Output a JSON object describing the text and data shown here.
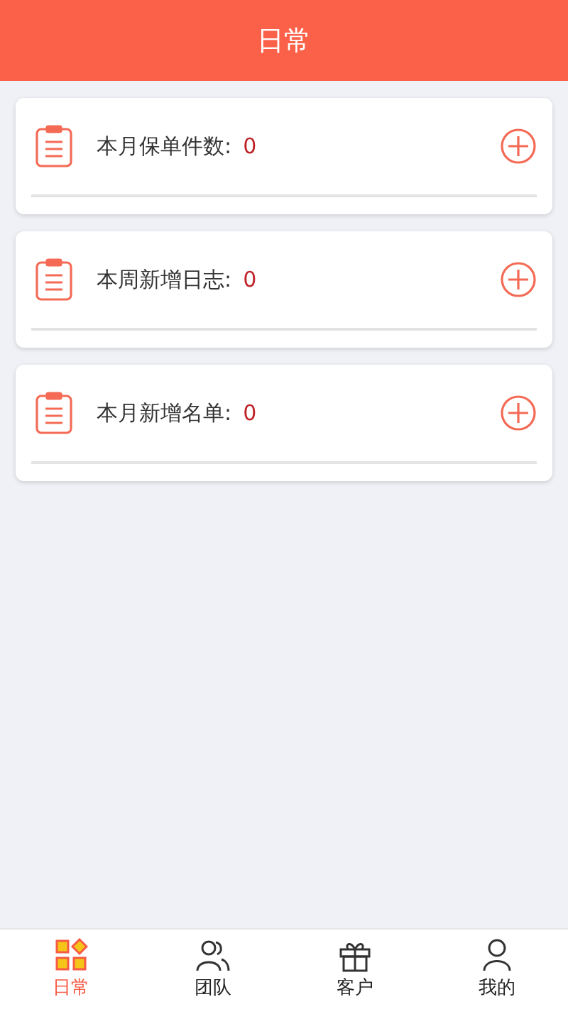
{
  "header": {
    "title": "日常"
  },
  "cards": [
    {
      "label": "本月保单件数:",
      "value": "0"
    },
    {
      "label": "本周新增日志:",
      "value": "0"
    },
    {
      "label": "本月新增名单:",
      "value": "0"
    }
  ],
  "tabs": [
    {
      "kind": "grid",
      "label": "日常",
      "selected": true
    },
    {
      "kind": "team",
      "label": "团队",
      "selected": false
    },
    {
      "kind": "gift",
      "label": "客户",
      "selected": false
    },
    {
      "kind": "person",
      "label": "我的",
      "selected": false
    }
  ]
}
